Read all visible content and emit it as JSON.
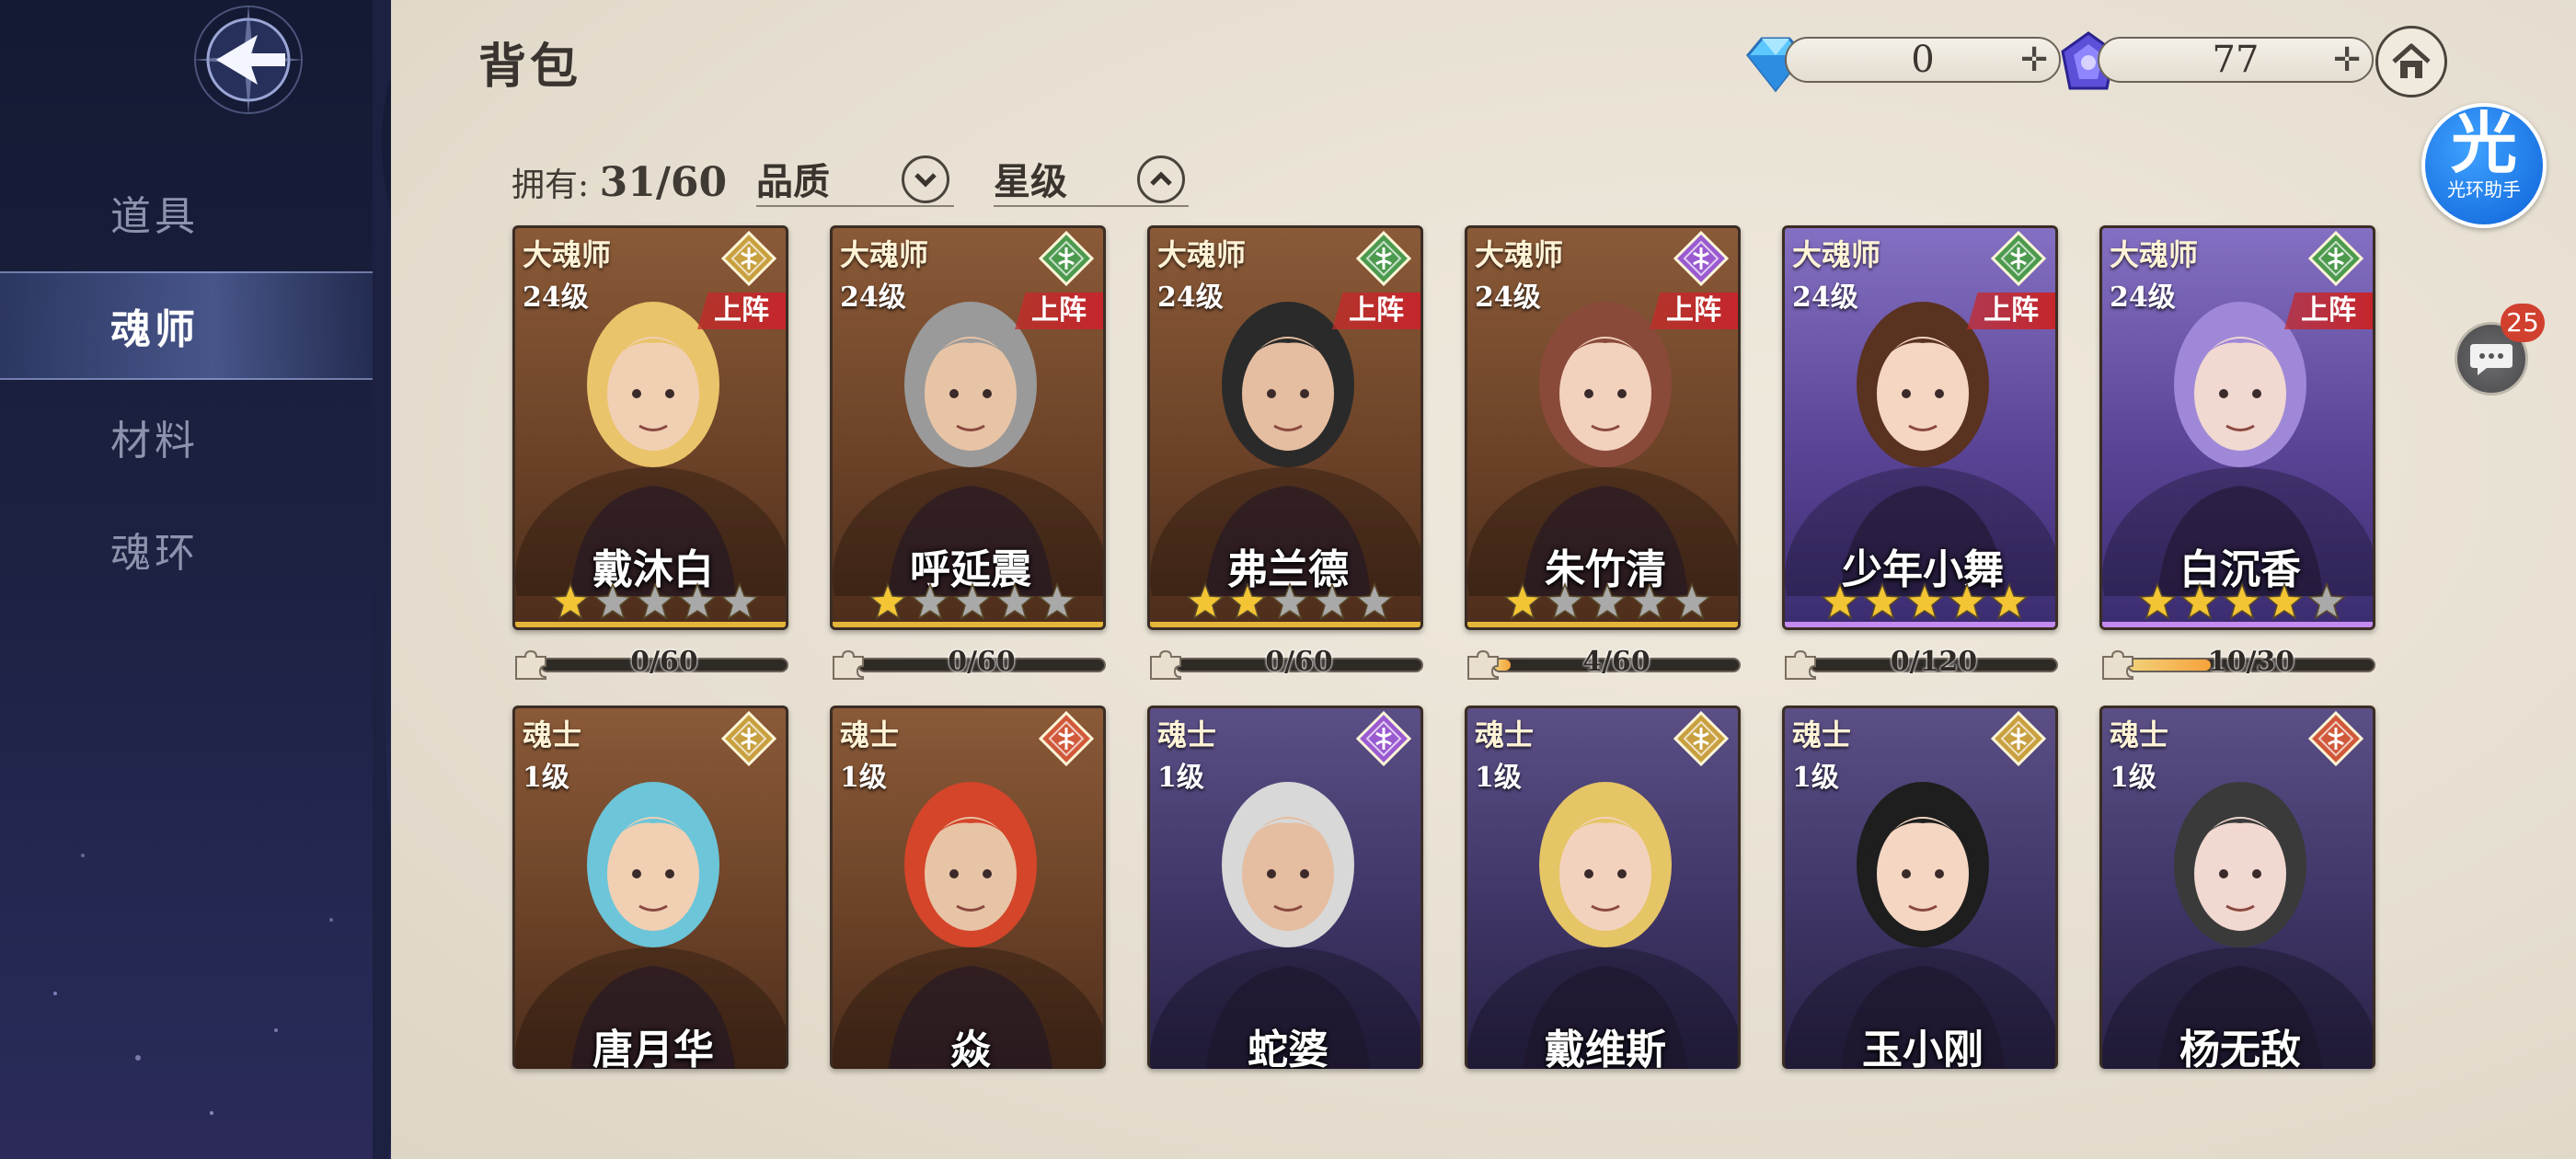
{
  "sidebar": {
    "items": [
      {
        "label": "道具",
        "active": false
      },
      {
        "label": "魂师",
        "active": true
      },
      {
        "label": "材料",
        "active": false
      },
      {
        "label": "魂环",
        "active": false
      }
    ]
  },
  "header": {
    "title": "背包",
    "currency": [
      {
        "icon": "diamond-icon",
        "value": "0"
      },
      {
        "icon": "crystal-icon",
        "value": "77"
      }
    ],
    "home_icon": "home-icon",
    "helper": {
      "big": "光",
      "small": "光环助手"
    },
    "chat_badge": "25"
  },
  "filters": {
    "owned_label": "拥有:",
    "owned_value": "31/60",
    "quality_label": "品质",
    "star_label": "星级"
  },
  "colors": {
    "deployed_red": "#c5262c",
    "star_gold": "#f3c534",
    "star_gray": "#a9a9a9"
  },
  "cards_row1": [
    {
      "rank": "大魂师",
      "level": "24级",
      "deployed": "上阵",
      "name": "戴沐白",
      "stars": 1,
      "progress_text": "0/60",
      "progress": 0.0,
      "bg": "brown",
      "class_color": "#c9a040",
      "class_icon": "axe-icon"
    },
    {
      "rank": "大魂师",
      "level": "24级",
      "deployed": "上阵",
      "name": "呼延震",
      "stars": 1,
      "progress_text": "0/60",
      "progress": 0.0,
      "bg": "brown",
      "class_color": "#4c9a4e",
      "class_icon": "shield-icon"
    },
    {
      "rank": "大魂师",
      "level": "24级",
      "deployed": "上阵",
      "name": "弗兰德",
      "stars": 2,
      "progress_text": "0/60",
      "progress": 0.0,
      "bg": "brown",
      "class_color": "#4c9a4e",
      "class_icon": "leaf-icon"
    },
    {
      "rank": "大魂师",
      "level": "24级",
      "deployed": "上阵",
      "name": "朱竹清",
      "stars": 1,
      "progress_text": "4/60",
      "progress": 0.067,
      "bg": "brown",
      "class_color": "#9a5ad0",
      "class_icon": "claw-icon"
    },
    {
      "rank": "大魂师",
      "level": "24级",
      "deployed": "上阵",
      "name": "少年小舞",
      "stars": 5,
      "progress_text": "0/120",
      "progress": 0.0,
      "bg": "purple",
      "class_color": "#4c9a4e",
      "class_icon": "claw-icon"
    },
    {
      "rank": "大魂师",
      "level": "24级",
      "deployed": "上阵",
      "name": "白沉香",
      "stars": 4,
      "progress_text": "10/30",
      "progress": 0.333,
      "bg": "purple",
      "class_color": "#4c9a4e",
      "class_icon": "claw-icon"
    }
  ],
  "cards_row2": [
    {
      "rank": "魂士",
      "level": "1级",
      "name": "唐月华",
      "bg": "brown",
      "class_color": "#c9a040",
      "class_icon": "wave-icon"
    },
    {
      "rank": "魂士",
      "level": "1级",
      "name": "焱",
      "bg": "brown",
      "class_color": "#d0593a",
      "class_icon": "shield-icon"
    },
    {
      "rank": "魂士",
      "level": "1级",
      "name": "蛇婆",
      "bg": "darkpurple",
      "class_color": "#9a5ad0",
      "class_icon": "claw-icon"
    },
    {
      "rank": "魂士",
      "level": "1级",
      "name": "戴维斯",
      "bg": "darkpurple",
      "class_color": "#c9a040",
      "class_icon": "axe-icon"
    },
    {
      "rank": "魂士",
      "level": "1级",
      "name": "玉小刚",
      "bg": "darkpurple",
      "class_color": "#c9a040",
      "class_icon": "axe-icon"
    },
    {
      "rank": "魂士",
      "level": "1级",
      "name": "杨无敌",
      "bg": "darkpurple",
      "class_color": "#d0593a",
      "class_icon": "axe-icon"
    }
  ]
}
